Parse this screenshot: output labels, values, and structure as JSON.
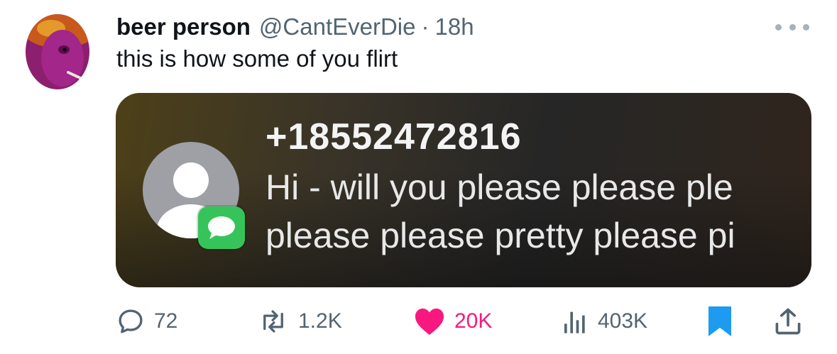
{
  "tweet": {
    "display_name": "beer person",
    "handle": "@CantEverDie",
    "separator": "·",
    "time": "18h",
    "text": "this is how some of you flirt",
    "more_icon": "ellipsis-icon"
  },
  "media": {
    "sender": "+18552472816",
    "preview_line1": "Hi - will you please please ple",
    "preview_line2": "please please pretty please pi",
    "contact_icon": "person-silhouette-icon",
    "app_badge_icon": "imessage-icon",
    "app_badge_color": "#36c45a"
  },
  "actions": {
    "replies": "72",
    "reposts": "1.2K",
    "likes": "20K",
    "views": "403K",
    "like_color": "#f91880",
    "bookmark_color": "#1d9bf0",
    "icon_color": "#536471"
  }
}
